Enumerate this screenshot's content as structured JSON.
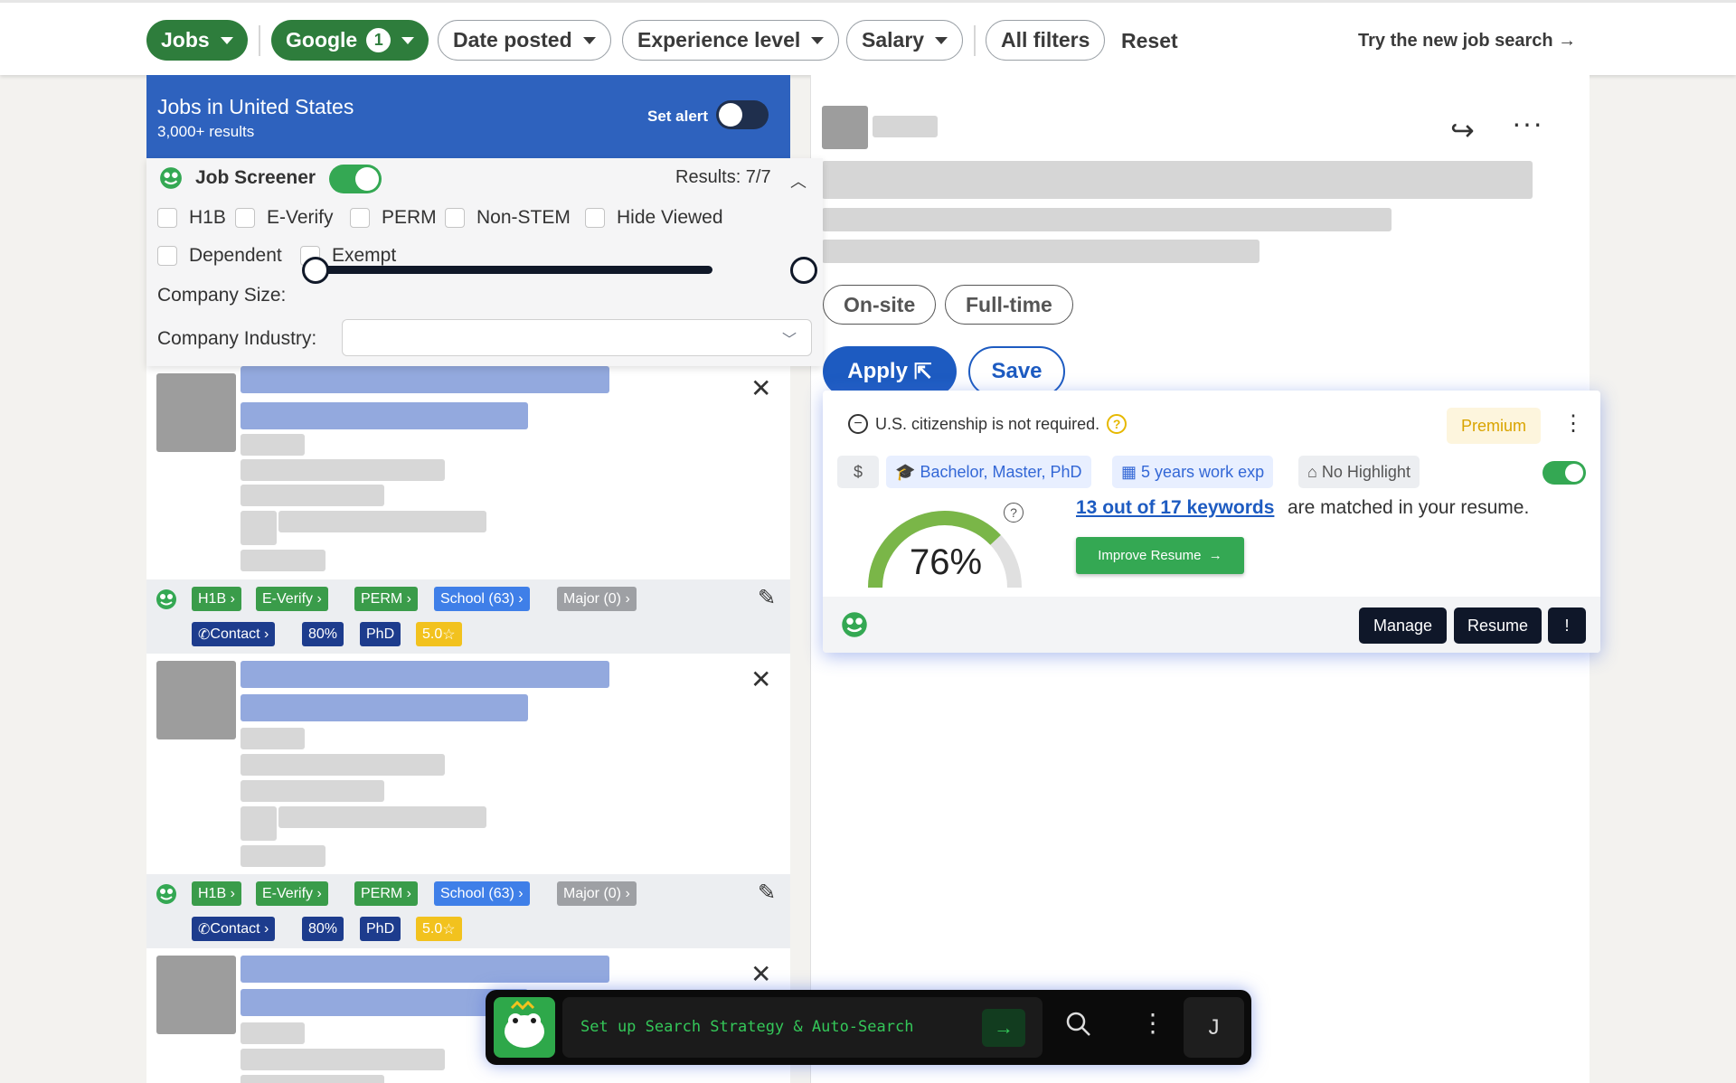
{
  "filters": {
    "jobs": "Jobs",
    "company": "Google",
    "company_count": "1",
    "date_posted": "Date posted",
    "experience": "Experience level",
    "salary": "Salary",
    "all_filters": "All filters",
    "reset": "Reset",
    "try_new": "Try the new job search →"
  },
  "list_header": {
    "title": "Jobs in United States",
    "results": "3,000+ results",
    "set_alert": "Set alert"
  },
  "screener": {
    "title": "Job Screener",
    "results": "Results: 7/7",
    "checkboxes": [
      "H1B",
      "E-Verify",
      "PERM",
      "Non-STEM",
      "Hide Viewed",
      "Dependent",
      "Exempt"
    ],
    "company_size_label": "Company Size:",
    "company_industry_label": "Company Industry:",
    "company_industry_value": ""
  },
  "job_tags": {
    "h1b": "H1B",
    "everify": "E-Verify",
    "perm": "PERM",
    "school": "School (63)",
    "major": "Major (0)",
    "contact": "Contact",
    "match": "80%",
    "degree": "PhD",
    "rating": "5.0"
  },
  "detail": {
    "chips": [
      "On-site",
      "Full-time"
    ],
    "apply": "Apply",
    "save": "Save"
  },
  "match_card": {
    "citizenship": "U.S. citizenship is not required.",
    "premium": "Premium",
    "salary_icon": "$",
    "degrees": "Bachelor, Master, PhD",
    "experience": "5 years work exp",
    "highlight": "No Highlight",
    "score": "76%",
    "score_value": 76,
    "keywords_link": "13 out of 17 keywords",
    "keywords_rest": "are matched in your resume.",
    "improve": "Improve Resume",
    "manage": "Manage",
    "resume": "Resume"
  },
  "bottom_bar": {
    "prompt": "Set up Search Strategy & Auto-Search",
    "avatar": "J"
  },
  "colors": {
    "filter_green": "#2e7d3c",
    "header_blue": "#2e62be",
    "apply_blue": "#1d5bc1",
    "toggle_green": "#34a853"
  }
}
